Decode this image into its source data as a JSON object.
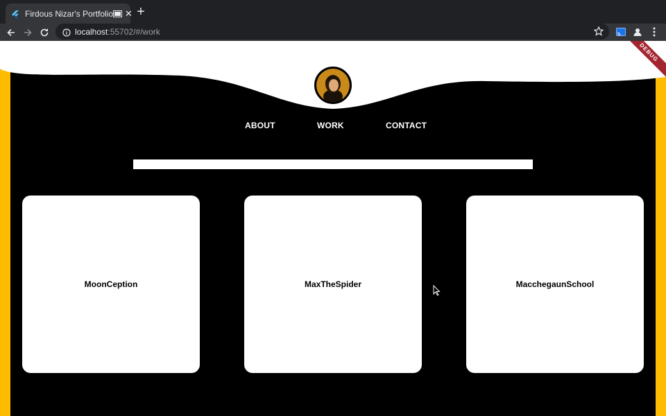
{
  "browser": {
    "tab": {
      "title": "Firdous Nizar's Portfolio"
    },
    "url": {
      "host": "localhost",
      "rest": ":55702/#/work"
    }
  },
  "page": {
    "debug_banner": "DEBUG",
    "nav": [
      {
        "label": "ABOUT"
      },
      {
        "label": "WORK"
      },
      {
        "label": "CONTACT"
      }
    ],
    "projects": [
      {
        "title": "MoonCeption"
      },
      {
        "title": "MaxTheSpider"
      },
      {
        "title": "MacchegaunSchool"
      }
    ],
    "colors": {
      "accent": "#ffbb00",
      "background": "#000000",
      "card": "#ffffff"
    }
  }
}
